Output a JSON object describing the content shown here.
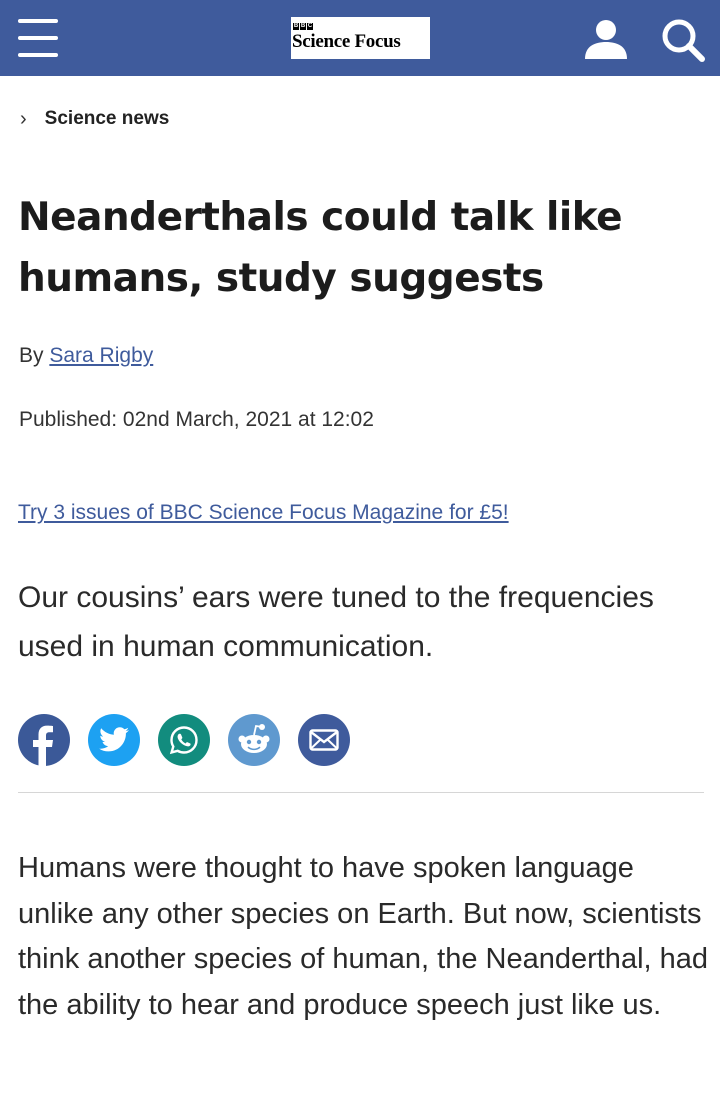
{
  "header": {
    "logo_bbc": [
      "B",
      "B",
      "C"
    ],
    "logo_text": "Science Focus",
    "bar_color": "#3f5b9c",
    "icons": [
      "menu-icon",
      "user-icon",
      "search-icon"
    ]
  },
  "breadcrumb": {
    "label": "Science news"
  },
  "article": {
    "headline": "Neanderthals could talk like humans, study suggests",
    "byline_prefix": "By",
    "author": "Sara Rigby",
    "published": "Published: 02nd March, 2021 at 12:02",
    "promo": "Try 3 issues of BBC Science Focus Magazine for £5!",
    "standfirst": "Our cousins’ ears were tuned to the frequencies used in human communication.",
    "body": "Humans were thought to have spoken language unlike any other species on Earth. But now, scientists think another species of human, the Neanderthal, had the ability to hear and produce speech just like us."
  },
  "share": [
    {
      "name": "facebook",
      "color": "#3b5998",
      "icon": "facebook-icon"
    },
    {
      "name": "twitter",
      "color": "#1da1f2",
      "icon": "twitter-icon"
    },
    {
      "name": "whatsapp",
      "color": "#128c7e",
      "icon": "whatsapp-icon"
    },
    {
      "name": "reddit",
      "color": "#5f99cf",
      "icon": "reddit-icon"
    },
    {
      "name": "email",
      "color": "#3f5b9c",
      "icon": "email-icon"
    }
  ]
}
